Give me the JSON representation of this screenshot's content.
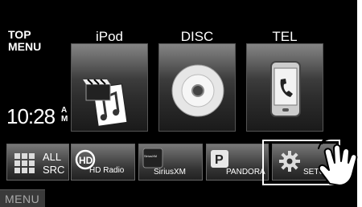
{
  "top_menu": {
    "line1": "TOP",
    "line2": "MENU"
  },
  "clock": {
    "time": "10:28",
    "am": "A",
    "pm": "M"
  },
  "sources": [
    {
      "label": "iPod",
      "icon": "ipod-icon"
    },
    {
      "label": "DISC",
      "icon": "disc-icon"
    },
    {
      "label": "TEL",
      "icon": "phone-icon"
    }
  ],
  "buttons": {
    "all_src_line1": "ALL",
    "all_src_line2": "SRC",
    "hd_radio": "HD Radio",
    "siriusxm": "SiriusXM",
    "siriusxm_logo_text": "SiriusXM",
    "pandora": "PANDORA",
    "setup": "SETUP"
  },
  "menu": {
    "label": "MENU"
  }
}
